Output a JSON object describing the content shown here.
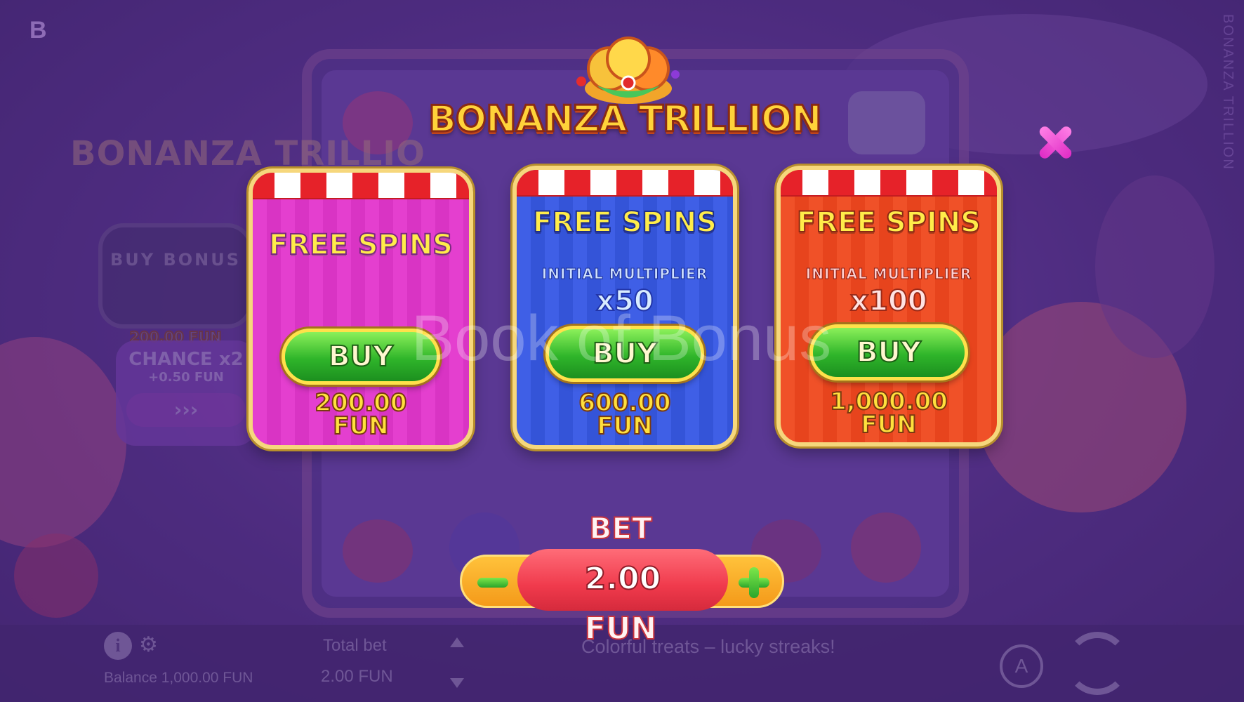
{
  "background": {
    "brand_mark": "B",
    "side_title": "BONANZA TRILLION",
    "logo_text": "BONANZA TRILLIO",
    "buy_bonus_label": "BUY BONUS",
    "buy_bonus_price": "200.00 FUN",
    "chance_label": "CHANCE x2",
    "chance_sub": "+0.50 FUN",
    "chance_arrow": "›››"
  },
  "bottom_bar": {
    "info_icon": "i",
    "balance": "Balance 1,000.00 FUN",
    "total_bet_label": "Total bet",
    "total_bet_value": "2.00 FUN",
    "tagline": "Colorful treats – lucky streaks!",
    "autoplay_label": "A"
  },
  "modal": {
    "logo_text": "BONANZA TRILLION",
    "cards": [
      {
        "title": "FREE SPINS",
        "buy_label": "BUY",
        "price": "200.00",
        "currency": "FUN",
        "color": "#e43fcf"
      },
      {
        "title": "FREE SPINS",
        "multiplier_label": "INITIAL MULTIPLIER",
        "multiplier": "x50",
        "buy_label": "BUY",
        "price": "600.00",
        "currency": "FUN",
        "color": "#3f5fe6"
      },
      {
        "title": "FREE SPINS",
        "multiplier_label": "INITIAL MULTIPLIER",
        "multiplier": "x100",
        "buy_label": "BUY",
        "price": "1,000.00",
        "currency": "FUN",
        "color": "#f05128"
      }
    ],
    "bet": {
      "label": "BET",
      "value": "2.00",
      "currency": "FUN"
    }
  },
  "watermark": "Book of Bonus",
  "colors": {
    "accent_gold": "#f6d77c",
    "buy_green": "#2fb52a",
    "close_pink": "#e02dc6",
    "bet_red": "#f03a4c"
  }
}
